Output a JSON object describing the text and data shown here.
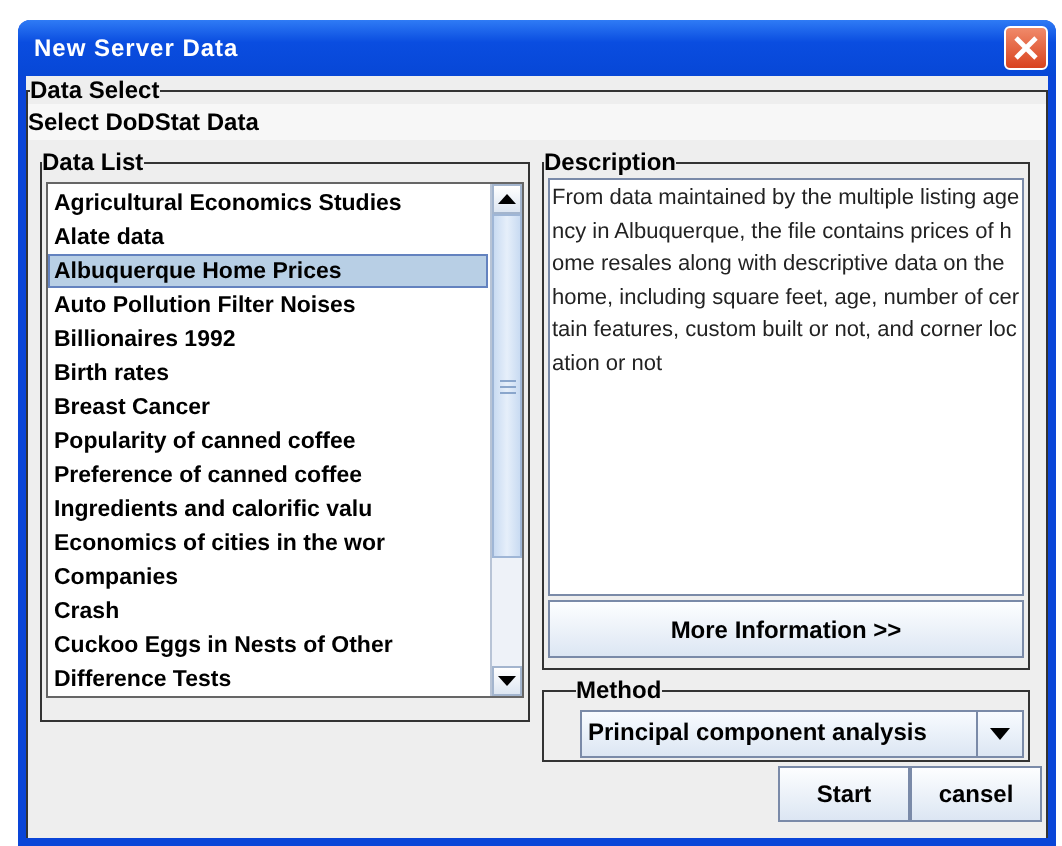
{
  "window": {
    "title": "New Server Data"
  },
  "data_select": {
    "legend": "Data Select",
    "label": "Select DoDStat Data"
  },
  "data_list": {
    "legend": "Data List",
    "items": [
      {
        "label": "Agricultural Economics Studies",
        "selected": false
      },
      {
        "label": "Alate data",
        "selected": false
      },
      {
        "label": "Albuquerque Home Prices",
        "selected": true
      },
      {
        "label": "Auto Pollution Filter Noises",
        "selected": false
      },
      {
        "label": "Billionaires 1992",
        "selected": false
      },
      {
        "label": "Birth rates",
        "selected": false
      },
      {
        "label": "Breast Cancer",
        "selected": false
      },
      {
        "label": "Popularity of canned coffee",
        "selected": false
      },
      {
        "label": "Preference of canned coffee",
        "selected": false
      },
      {
        "label": "Ingredients and calorific valu",
        "selected": false
      },
      {
        "label": "Economics of cities in the wor",
        "selected": false
      },
      {
        "label": "Companies",
        "selected": false
      },
      {
        "label": "Crash",
        "selected": false
      },
      {
        "label": "Cuckoo Eggs in Nests of Other",
        "selected": false
      },
      {
        "label": "Difference Tests",
        "selected": false
      }
    ]
  },
  "description": {
    "legend": "Description",
    "text": "From data maintained by the multiple listing agency in Albuquerque, the file contains prices of home resales along with descriptive data on the home, including square feet, age, number of certain features, custom built or not, and corner location or not",
    "button": "More Information >>"
  },
  "method": {
    "legend": "Method",
    "value": "Principal component analysis"
  },
  "buttons": [
    "Start",
    "cansel"
  ]
}
